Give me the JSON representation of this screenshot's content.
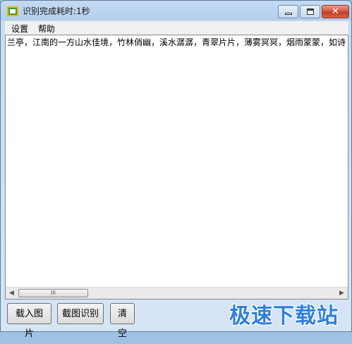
{
  "window": {
    "title": "识别完成耗时:1秒",
    "minimize_icon": "minimize-icon",
    "maximize_icon": "maximize-icon",
    "close_icon": "close-icon",
    "close_color": "#c7462e"
  },
  "menu": {
    "settings": "设置",
    "help": "帮助"
  },
  "editor": {
    "text": "兰亭，江南的一方山水佳境，竹林俏幽，溪水潺潺，青翠片片，薄雾冥冥，烟雨蒙蒙，如诗"
  },
  "scrollbar": {
    "thumb_grip": "III"
  },
  "buttons": {
    "load_image": "载入图片",
    "capture_recognize": "截图识别",
    "clear": "清空"
  },
  "watermark": "极速下载站"
}
